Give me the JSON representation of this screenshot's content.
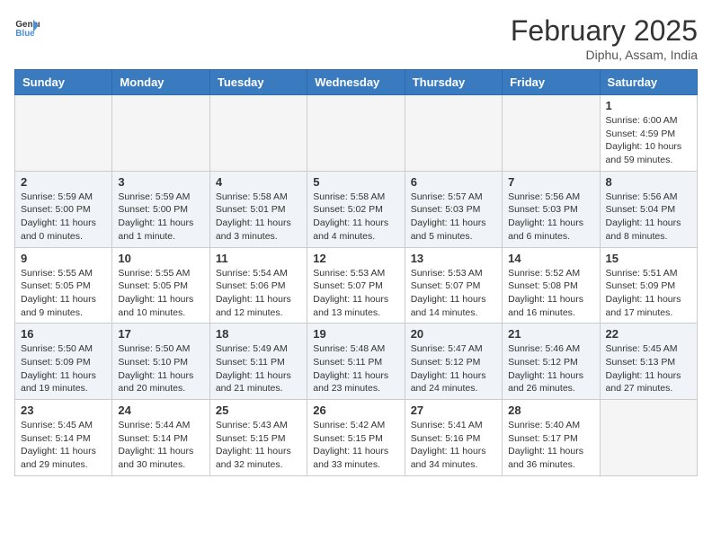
{
  "header": {
    "logo_general": "General",
    "logo_blue": "Blue",
    "month_year": "February 2025",
    "location": "Diphu, Assam, India"
  },
  "weekdays": [
    "Sunday",
    "Monday",
    "Tuesday",
    "Wednesday",
    "Thursday",
    "Friday",
    "Saturday"
  ],
  "weeks": [
    [
      {
        "day": "",
        "info": ""
      },
      {
        "day": "",
        "info": ""
      },
      {
        "day": "",
        "info": ""
      },
      {
        "day": "",
        "info": ""
      },
      {
        "day": "",
        "info": ""
      },
      {
        "day": "",
        "info": ""
      },
      {
        "day": "1",
        "info": "Sunrise: 6:00 AM\nSunset: 4:59 PM\nDaylight: 10 hours\nand 59 minutes."
      }
    ],
    [
      {
        "day": "2",
        "info": "Sunrise: 5:59 AM\nSunset: 5:00 PM\nDaylight: 11 hours\nand 0 minutes."
      },
      {
        "day": "3",
        "info": "Sunrise: 5:59 AM\nSunset: 5:00 PM\nDaylight: 11 hours\nand 1 minute."
      },
      {
        "day": "4",
        "info": "Sunrise: 5:58 AM\nSunset: 5:01 PM\nDaylight: 11 hours\nand 3 minutes."
      },
      {
        "day": "5",
        "info": "Sunrise: 5:58 AM\nSunset: 5:02 PM\nDaylight: 11 hours\nand 4 minutes."
      },
      {
        "day": "6",
        "info": "Sunrise: 5:57 AM\nSunset: 5:03 PM\nDaylight: 11 hours\nand 5 minutes."
      },
      {
        "day": "7",
        "info": "Sunrise: 5:56 AM\nSunset: 5:03 PM\nDaylight: 11 hours\nand 6 minutes."
      },
      {
        "day": "8",
        "info": "Sunrise: 5:56 AM\nSunset: 5:04 PM\nDaylight: 11 hours\nand 8 minutes."
      }
    ],
    [
      {
        "day": "9",
        "info": "Sunrise: 5:55 AM\nSunset: 5:05 PM\nDaylight: 11 hours\nand 9 minutes."
      },
      {
        "day": "10",
        "info": "Sunrise: 5:55 AM\nSunset: 5:05 PM\nDaylight: 11 hours\nand 10 minutes."
      },
      {
        "day": "11",
        "info": "Sunrise: 5:54 AM\nSunset: 5:06 PM\nDaylight: 11 hours\nand 12 minutes."
      },
      {
        "day": "12",
        "info": "Sunrise: 5:53 AM\nSunset: 5:07 PM\nDaylight: 11 hours\nand 13 minutes."
      },
      {
        "day": "13",
        "info": "Sunrise: 5:53 AM\nSunset: 5:07 PM\nDaylight: 11 hours\nand 14 minutes."
      },
      {
        "day": "14",
        "info": "Sunrise: 5:52 AM\nSunset: 5:08 PM\nDaylight: 11 hours\nand 16 minutes."
      },
      {
        "day": "15",
        "info": "Sunrise: 5:51 AM\nSunset: 5:09 PM\nDaylight: 11 hours\nand 17 minutes."
      }
    ],
    [
      {
        "day": "16",
        "info": "Sunrise: 5:50 AM\nSunset: 5:09 PM\nDaylight: 11 hours\nand 19 minutes."
      },
      {
        "day": "17",
        "info": "Sunrise: 5:50 AM\nSunset: 5:10 PM\nDaylight: 11 hours\nand 20 minutes."
      },
      {
        "day": "18",
        "info": "Sunrise: 5:49 AM\nSunset: 5:11 PM\nDaylight: 11 hours\nand 21 minutes."
      },
      {
        "day": "19",
        "info": "Sunrise: 5:48 AM\nSunset: 5:11 PM\nDaylight: 11 hours\nand 23 minutes."
      },
      {
        "day": "20",
        "info": "Sunrise: 5:47 AM\nSunset: 5:12 PM\nDaylight: 11 hours\nand 24 minutes."
      },
      {
        "day": "21",
        "info": "Sunrise: 5:46 AM\nSunset: 5:12 PM\nDaylight: 11 hours\nand 26 minutes."
      },
      {
        "day": "22",
        "info": "Sunrise: 5:45 AM\nSunset: 5:13 PM\nDaylight: 11 hours\nand 27 minutes."
      }
    ],
    [
      {
        "day": "23",
        "info": "Sunrise: 5:45 AM\nSunset: 5:14 PM\nDaylight: 11 hours\nand 29 minutes."
      },
      {
        "day": "24",
        "info": "Sunrise: 5:44 AM\nSunset: 5:14 PM\nDaylight: 11 hours\nand 30 minutes."
      },
      {
        "day": "25",
        "info": "Sunrise: 5:43 AM\nSunset: 5:15 PM\nDaylight: 11 hours\nand 32 minutes."
      },
      {
        "day": "26",
        "info": "Sunrise: 5:42 AM\nSunset: 5:15 PM\nDaylight: 11 hours\nand 33 minutes."
      },
      {
        "day": "27",
        "info": "Sunrise: 5:41 AM\nSunset: 5:16 PM\nDaylight: 11 hours\nand 34 minutes."
      },
      {
        "day": "28",
        "info": "Sunrise: 5:40 AM\nSunset: 5:17 PM\nDaylight: 11 hours\nand 36 minutes."
      },
      {
        "day": "",
        "info": ""
      }
    ]
  ]
}
